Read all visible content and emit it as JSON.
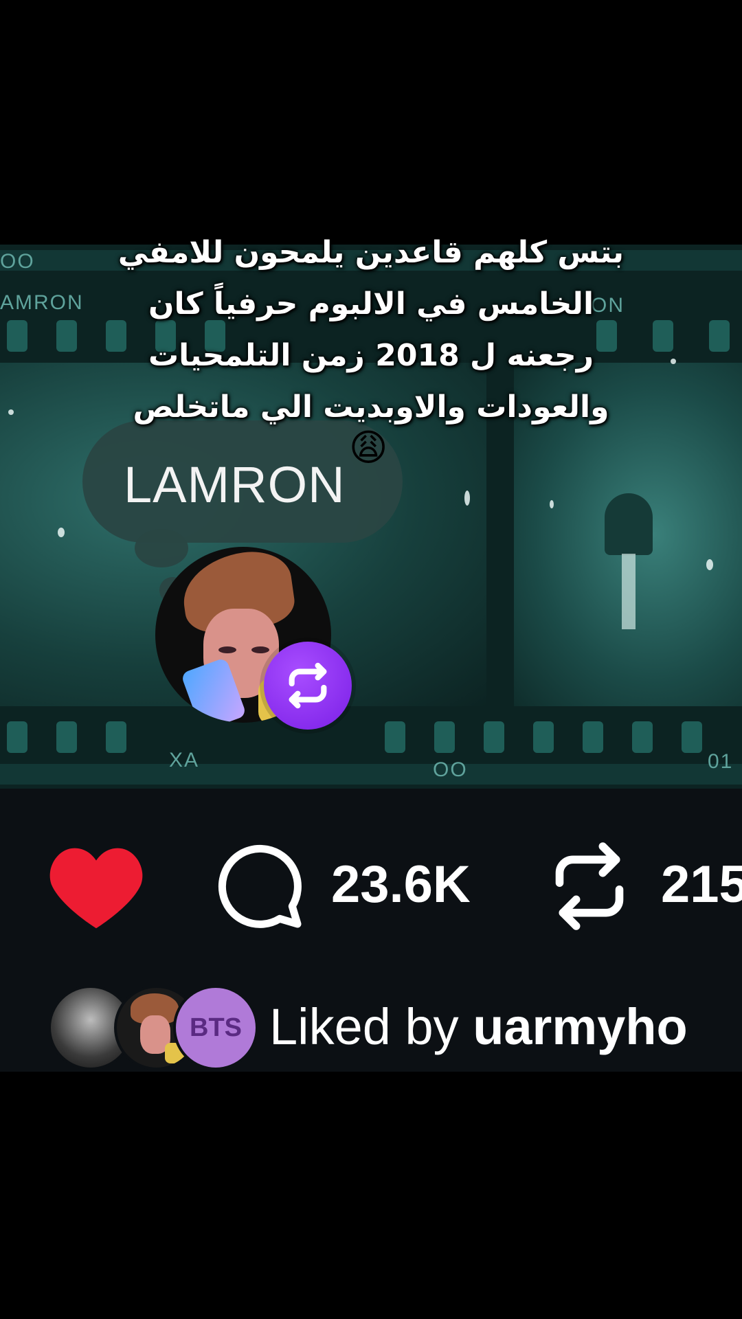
{
  "caption": {
    "line1": "بتس كلهم قاعدين يلمحون للامفي",
    "line2": "الخامس في الالبوم حرفياً كان",
    "line3": "رجعنه ل 2018 زمن التلمحيات",
    "line4": "والعودات والاوبديت الي ماتخلص",
    "emoji": "😩"
  },
  "film": {
    "label_top_left": "OO",
    "label_left": "AMRON",
    "label_right": "ON",
    "label_bottom_left": "XA",
    "label_bottom_mid": "OO",
    "label_bottom_right": "01"
  },
  "thought_bubble": {
    "text": "LAMRON"
  },
  "avatar": {
    "name": "profile-avatar",
    "badge_icon": "repost-icon"
  },
  "actions": {
    "like_icon": "heart-icon",
    "like_color": "#ed1c32",
    "comment_icon": "comment-icon",
    "comment_count": "23.6K",
    "repost_icon": "repost-icon",
    "repost_count": "215"
  },
  "liked_by": {
    "prefix": "Liked by ",
    "user": "uarmyho",
    "avatar3_text": "BTS"
  },
  "colors": {
    "accent_purple": "#8a2be2",
    "background_dark": "#0c1014",
    "film_teal": "#1f5e58"
  }
}
